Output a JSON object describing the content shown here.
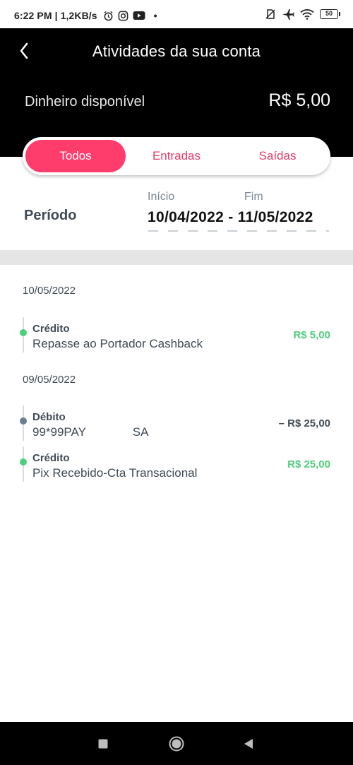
{
  "status_bar": {
    "time_speed": "6:22 PM | 1,2KB/s",
    "dot": "•",
    "battery": "50",
    "icons": [
      "alarm-icon",
      "instagram-icon",
      "youtube-icon",
      "no-sim-icon",
      "airplane-icon",
      "wifi-icon",
      "battery-icon"
    ]
  },
  "header": {
    "title": "Atividades da sua conta",
    "balance_label": "Dinheiro disponível",
    "balance_value": "R$ 5,00"
  },
  "tabs": [
    {
      "label": "Todos",
      "active": true
    },
    {
      "label": "Entradas",
      "active": false
    },
    {
      "label": "Saídas",
      "active": false
    }
  ],
  "period": {
    "label": "Período",
    "start_label": "Início",
    "end_label": "Fim",
    "range": "10/04/2022 - 11/05/2022"
  },
  "days": [
    {
      "date": "10/05/2022",
      "transactions": [
        {
          "type": "Crédito",
          "description": "Repasse ao Portador Cashback",
          "amount": "R$ 5,00",
          "kind": "credit"
        }
      ]
    },
    {
      "date": "09/05/2022",
      "transactions": [
        {
          "type": "Débito",
          "description": "99*99PAY              SA",
          "amount": "– R$ 25,00",
          "kind": "debit"
        },
        {
          "type": "Crédito",
          "description": "Pix Recebido-Cta Transacional",
          "amount": "R$ 25,00",
          "kind": "credit"
        }
      ]
    }
  ],
  "colors": {
    "accent": "#ff3d6c",
    "tab_text": "#e43b67",
    "credit": "#4fce7d",
    "debit_dot": "#6a7f95",
    "text_dark": "#3f4a55",
    "header_bg": "#000000"
  }
}
